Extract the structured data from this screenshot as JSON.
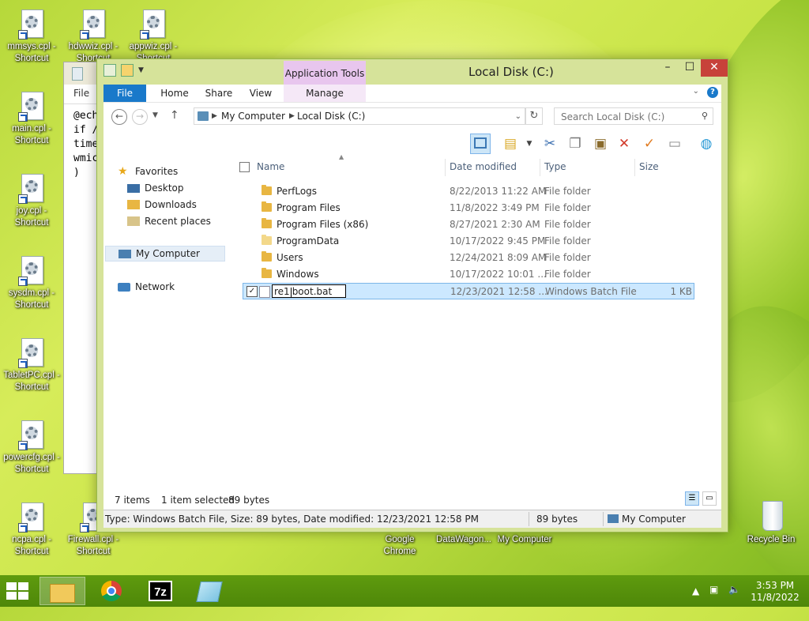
{
  "desktop": {
    "icons": [
      {
        "label": "mmsys.cpl - Shortcut"
      },
      {
        "label": "hdwwiz.cpl - Shortcut"
      },
      {
        "label": "appwiz.cpl - Shortcut"
      },
      {
        "label": "main.cpl - Shortcut"
      },
      {
        "label": "joy.cpl - Shortcut"
      },
      {
        "label": "sysdm.cpl - Shortcut"
      },
      {
        "label": "TabletPC.cpl - Shortcut"
      },
      {
        "label": "powercfg.cpl - Shortcut"
      },
      {
        "label": "ncpa.cpl - Shortcut"
      },
      {
        "label": "Firewall.cpl - Shortcut"
      },
      {
        "label": "Google Chrome"
      },
      {
        "label": "DataWagon..."
      },
      {
        "label": "My Computer"
      },
      {
        "label": "Recycle Bin"
      }
    ]
  },
  "notepad": {
    "menu_file": "File",
    "lines": [
      "@ech",
      "if /",
      "time",
      "wmic",
      ")"
    ]
  },
  "explorer": {
    "title": "Local Disk (C:)",
    "context_tab": "Application Tools",
    "tabs": {
      "file": "File",
      "home": "Home",
      "share": "Share",
      "view": "View",
      "manage": "Manage"
    },
    "window_buttons": {
      "minimize": "–",
      "maximize": "☐",
      "close": "✕"
    },
    "address": {
      "parts": [
        "My Computer",
        "Local Disk (C:)"
      ]
    },
    "search_placeholder": "Search Local Disk (C:)",
    "nav_pane": {
      "favorites": "Favorites",
      "desktop": "Desktop",
      "downloads": "Downloads",
      "recent": "Recent places",
      "computer": "My Computer",
      "network": "Network"
    },
    "columns": {
      "name": "Name",
      "date": "Date modified",
      "type": "Type",
      "size": "Size"
    },
    "files": [
      {
        "name": "PerfLogs",
        "date": "8/22/2013 11:22 AM",
        "type": "File folder",
        "size": ""
      },
      {
        "name": "Program Files",
        "date": "11/8/2022 3:49 PM",
        "type": "File folder",
        "size": ""
      },
      {
        "name": "Program Files (x86)",
        "date": "8/27/2021 2:30 AM",
        "type": "File folder",
        "size": ""
      },
      {
        "name": "ProgramData",
        "date": "10/17/2022 9:45 PM",
        "type": "File folder",
        "size": ""
      },
      {
        "name": "Users",
        "date": "12/24/2021 8:09 AM",
        "type": "File folder",
        "size": ""
      },
      {
        "name": "Windows",
        "date": "10/17/2022 10:01 ...",
        "type": "File folder",
        "size": ""
      },
      {
        "name": "re1boot.bat",
        "rename_before": "re1",
        "rename_after": "boot.bat",
        "date": "12/23/2021 12:58 ...",
        "type": "Windows Batch File",
        "size": "1 KB"
      }
    ],
    "status": {
      "items": "7 items",
      "selected": "1 item selected",
      "bytes": "89 bytes"
    },
    "details": {
      "text": "Type: Windows Batch File, Size: 89 bytes, Date modified: 12/23/2021 12:58 PM",
      "size": "89 bytes",
      "location": "My Computer"
    }
  },
  "taskbar": {
    "time": "3:53 PM",
    "date": "11/8/2022",
    "apps": [
      "file-explorer",
      "chrome",
      "7zip",
      "notepad"
    ],
    "seven_zip_label": "7z"
  },
  "colors": {
    "accent": "#1979ca",
    "taskbar": "#5a950d",
    "selection": "#cce8ff"
  }
}
